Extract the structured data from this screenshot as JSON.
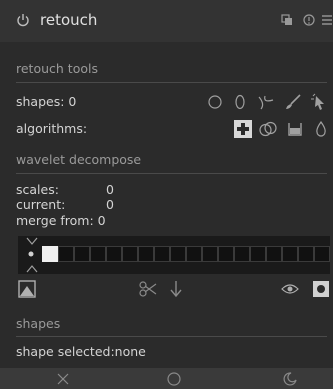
{
  "header": {
    "title": "retouch",
    "icons": [
      "power-icon",
      "multi-instance-icon",
      "reset-icon",
      "presets-icon"
    ]
  },
  "retouch_tools": {
    "section_label": "retouch tools",
    "shapes_label": "shapes: 0",
    "algorithms_label": "algorithms:",
    "shape_icons": [
      "circle-icon",
      "ellipse-icon",
      "path-icon",
      "brush-icon",
      "pick-icon"
    ],
    "algorithm_icons": [
      "heal-icon",
      "clone-icon",
      "fill-icon",
      "blur-icon"
    ]
  },
  "wavelet": {
    "section_label": "wavelet decompose",
    "scales_label": "scales:",
    "scales_value": "0",
    "current_label": "current:",
    "current_value": "0",
    "merge_label": "merge from: 0",
    "cell_count": 18,
    "active_index": 0
  },
  "shapes": {
    "section_label": "shapes",
    "selected_label": "shape selected:none"
  },
  "bottombar": {
    "icons": [
      "close-icon",
      "circle-icon",
      "crescent-icon"
    ]
  },
  "colors": {
    "background": "#2b2b2b",
    "header": "#333333",
    "text": "#d4d4d4",
    "section": "#9a9a9a"
  }
}
